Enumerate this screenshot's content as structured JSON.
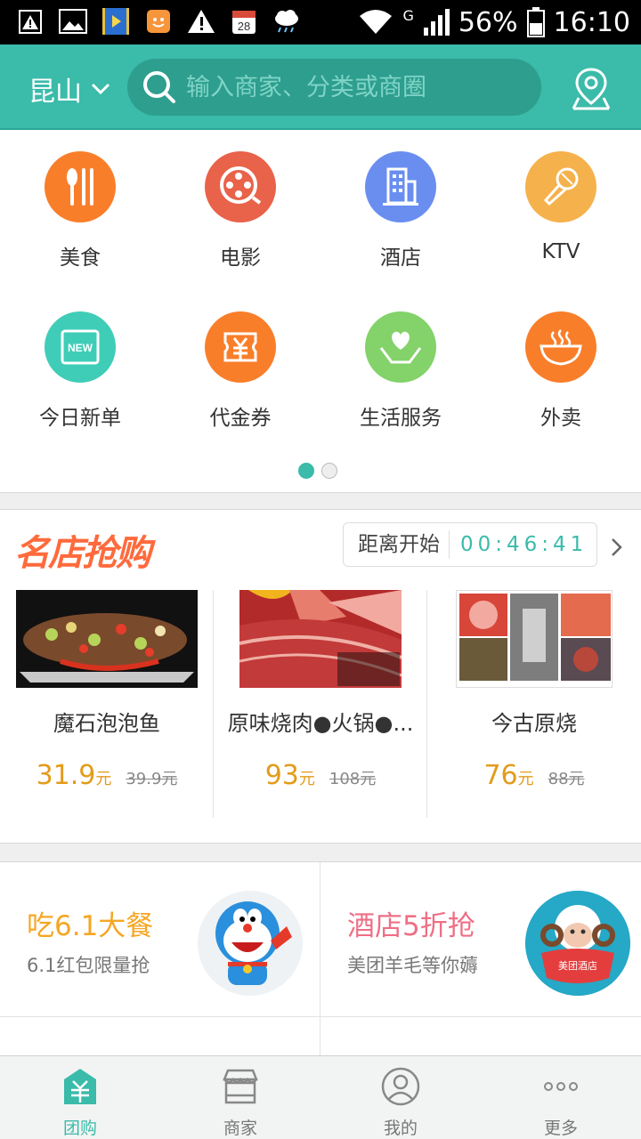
{
  "status_bar": {
    "battery": "56%",
    "time": "16:10",
    "network": "G",
    "calendar_day": "28",
    "icons": [
      "warning-icon",
      "image-icon",
      "video-icon",
      "app-icon",
      "alert-icon",
      "calendar-icon",
      "weather-icon",
      "wifi-icon",
      "signal-icon",
      "battery-icon"
    ]
  },
  "header": {
    "city": "昆山",
    "search_placeholder": "输入商家、分类或商圈"
  },
  "categories": [
    {
      "label": "美食",
      "icon": "food-icon",
      "color": "#f97e2a"
    },
    {
      "label": "电影",
      "icon": "film-reel-icon",
      "color": "#e9624a"
    },
    {
      "label": "酒店",
      "icon": "hotel-building-icon",
      "color": "#6a8ef0"
    },
    {
      "label": "KTV",
      "icon": "microphone-icon",
      "color": "#f5b14b"
    },
    {
      "label": "今日新单",
      "icon": "new-badge-icon",
      "color": "#3fcdb7",
      "badge": "NEW"
    },
    {
      "label": "代金券",
      "icon": "voucher-icon",
      "color": "#f97e2a"
    },
    {
      "label": "生活服务",
      "icon": "heart-hands-icon",
      "color": "#83d26a"
    },
    {
      "label": "外卖",
      "icon": "bowl-icon",
      "color": "#f97e2a"
    }
  ],
  "page_dots": {
    "count": 2,
    "active": 0
  },
  "flash_sale": {
    "title": "名店抢购",
    "countdown_label": "距离开始",
    "countdown_time": "00:46:41",
    "deals": [
      {
        "name": "魔石泡泡鱼",
        "price": "31.9",
        "unit": "元",
        "old_price": "39.9元"
      },
      {
        "name": "原味烧肉●火锅●...",
        "price": "93",
        "unit": "元",
        "old_price": "108元"
      },
      {
        "name": "今古原烧",
        "price": "76",
        "unit": "元",
        "old_price": "88元"
      }
    ]
  },
  "promos": [
    {
      "title": "吃6.1大餐",
      "subtitle": "6.1红包限量抢",
      "color": "#f5a623"
    },
    {
      "title": "酒店5折抢",
      "subtitle": "美团羊毛等你薅",
      "color": "#ee6f86",
      "image_text": "美团酒店"
    }
  ],
  "tabbar": [
    {
      "label": "团购",
      "icon": "groupbuy-icon",
      "active": true
    },
    {
      "label": "商家",
      "icon": "store-icon",
      "active": false
    },
    {
      "label": "我的",
      "icon": "profile-icon",
      "active": false
    },
    {
      "label": "更多",
      "icon": "more-icon",
      "active": false
    }
  ],
  "colors": {
    "accent": "#3bbbaa",
    "price": "#e39b1a"
  }
}
